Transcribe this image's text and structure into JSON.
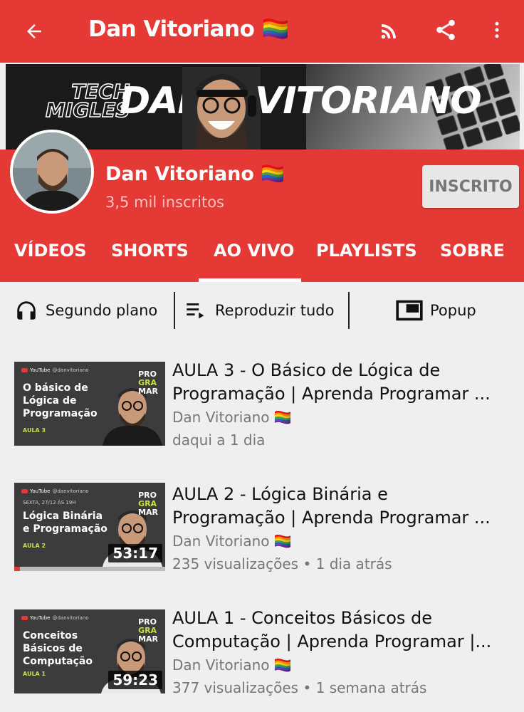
{
  "header": {
    "title": "Dan Vitoriano 🏳️‍🌈",
    "back_icon": "arrow-left-icon",
    "rss_icon": "rss-icon",
    "share_icon": "share-icon",
    "more_icon": "more-vertical-icon",
    "background_color": "#e53935"
  },
  "banner": {
    "tech_line1": "TECH",
    "tech_line2": "MIGLES",
    "name_left": "DAN",
    "name_right": "VITORIANO"
  },
  "channel": {
    "name": "Dan Vitoriano 🏳️‍🌈",
    "subscribers": "3,5 mil inscritos",
    "subscribe_label": "INSCRITO"
  },
  "tabs": [
    {
      "label": "VÍDEOS"
    },
    {
      "label": "SHORTS"
    },
    {
      "label": "AO VIVO",
      "selected": true
    },
    {
      "label": "PLAYLISTS"
    },
    {
      "label": "SOBRE"
    }
  ],
  "actions": {
    "background": {
      "label": "Segundo plano",
      "icon": "headphones-icon"
    },
    "play_all": {
      "label": "Reproduzir tudo",
      "icon": "playlist-play-icon"
    },
    "popup": {
      "label": "Popup",
      "icon": "picture-in-picture-icon"
    }
  },
  "videos": [
    {
      "title_line1": "AULA 3 - O Básico de Lógica de",
      "title_line2": "Programação | Aprenda Programar ...",
      "channel": "Dan Vitoriano 🏳️‍🌈",
      "meta": "daqui a 1 dia",
      "duration": "",
      "thumb": {
        "yt": "YouTube",
        "handle": "@danvitoriano",
        "subhead": "",
        "text_line1": "O básico de",
        "text_line2": "Lógica de",
        "text_line3": "Programação",
        "aula": "AULA 3",
        "prog1": "PRO",
        "prog2": "GRA",
        "prog3": "MAR"
      }
    },
    {
      "title_line1": "AULA 2 - Lógica Binária e",
      "title_line2": "Programação | Aprenda Programar ...",
      "channel": "Dan Vitoriano 🏳️‍🌈",
      "meta": "235 visualizações • 1 dia atrás",
      "duration": "53:17",
      "watched_fraction": 0.04,
      "thumb": {
        "yt": "YouTube",
        "handle": "@danvitoriano",
        "subhead": "SEXTA, 27/12 ÀS 19H",
        "text_line1": "Lógica Binária",
        "text_line2": "e Programação",
        "text_line3": "",
        "aula": "AULA 2",
        "prog1": "PRO",
        "prog2": "GRA",
        "prog3": "MAR"
      }
    },
    {
      "title_line1": "AULA 1 - Conceitos Básicos de",
      "title_line2": "Computação | Aprenda Programar |...",
      "channel": "Dan Vitoriano 🏳️‍🌈",
      "meta": "377 visualizações • 1 semana atrás",
      "duration": "59:23",
      "thumb": {
        "yt": "YouTube",
        "handle": "@danvitoriano",
        "subhead": "",
        "text_line1": "Conceitos",
        "text_line2": "Básicos de",
        "text_line3": "Computação",
        "aula": "AULA 1",
        "prog1": "PRO",
        "prog2": "GRA",
        "prog3": "MAR"
      }
    }
  ]
}
